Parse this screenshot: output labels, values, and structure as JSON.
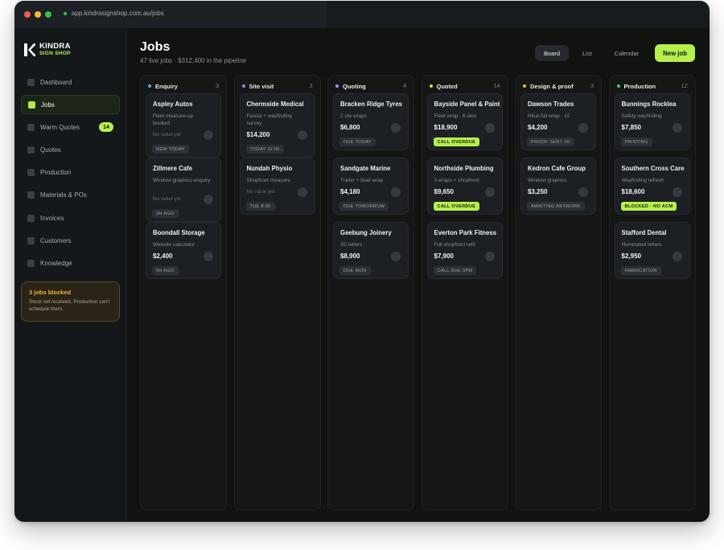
{
  "browser": {
    "url": "app.kindrasignshop.com.au/jobs"
  },
  "brand": {
    "name": "KINDRA",
    "sub": "SIGN SHOP"
  },
  "sidebar": {
    "items": [
      {
        "label": "Dashboard"
      },
      {
        "label": "Jobs",
        "active": true
      },
      {
        "label": "Warm Quotes",
        "badge": "14"
      },
      {
        "label": "Quotes"
      },
      {
        "label": "Production"
      },
      {
        "label": "Materials & POs"
      },
      {
        "label": "Invoices"
      },
      {
        "label": "Customers"
      },
      {
        "label": "Knowledge"
      }
    ],
    "alert": {
      "title": "3 jobs blocked",
      "body": "Stock not received. Production can't schedule them."
    }
  },
  "header": {
    "title": "Jobs",
    "subtitle": "47 live jobs · $312,400 in the pipeline",
    "views": [
      "Board",
      "List",
      "Calendar"
    ],
    "new_button": "New job"
  },
  "colors": {
    "accent": "#b5f04b",
    "enquiry": "#5aa9f0",
    "site_visit": "#8a8df5",
    "quoting": "#a78bfa",
    "quoted": "#b5f04b",
    "design": "#f2b632",
    "production": "#3ecf6a"
  },
  "columns": [
    {
      "title": "Enquiry",
      "count": "3",
      "dot": "#5aa9f0",
      "cards": [
        {
          "name": "Aspley Autos",
          "desc": "Fleet measure-up booked",
          "value": "No value yet",
          "tag": "NEW TODAY"
        },
        {
          "name": "Zillmere Cafe",
          "desc": "Window graphics enquiry",
          "value": "No value yet",
          "tag": "2H AGO"
        },
        {
          "name": "Boondall Storage",
          "desc": "Website calculator",
          "value": "$2,400",
          "tag": "5H AGO"
        }
      ]
    },
    {
      "title": "Site visit",
      "count": "2",
      "dot": "#8a8df5",
      "cards": [
        {
          "name": "Chermside Medical",
          "desc": "Fascia + wayfinding survey",
          "value": "$14,200",
          "tag": "TODAY 11:00"
        },
        {
          "name": "Nundah Physio",
          "desc": "Shopfront measure",
          "value": "No value yet",
          "tag": "TUE 8:30"
        }
      ]
    },
    {
      "title": "Quoting",
      "count": "4",
      "dot": "#a78bfa",
      "cards": [
        {
          "name": "Bracken Ridge Tyres",
          "desc": "2 ute wraps",
          "value": "$6,800",
          "tag": "DUE TODAY"
        },
        {
          "name": "Sandgate Marine",
          "desc": "Trailer + boat wrap",
          "value": "$4,180",
          "tag": "DUE TOMORROW"
        },
        {
          "name": "Geebung Joinery",
          "desc": "3D letters",
          "value": "$8,900",
          "tag": "DUE MON"
        }
      ]
    },
    {
      "title": "Quoted",
      "count": "14",
      "dot": "#b5f04b",
      "cards": [
        {
          "name": "Bayside Panel & Paint",
          "desc": "Fleet wrap · 6 utes",
          "value": "$18,900",
          "tag": "CALL OVERDUE",
          "hot": true
        },
        {
          "name": "Northside Plumbing",
          "desc": "3 wraps + shopfront",
          "value": "$9,650",
          "tag": "CALL OVERDUE",
          "hot": true
        },
        {
          "name": "Everton Park Fitness",
          "desc": "Full shopfront refit",
          "value": "$7,900",
          "tag": "CALL DUE 3PM"
        }
      ]
    },
    {
      "title": "Design & proof",
      "count": "3",
      "dot": "#f2b632",
      "cards": [
        {
          "name": "Dawson Trades",
          "desc": "Hilux full wrap · v2",
          "value": "$4,200",
          "tag": "PROOF SENT 2D"
        },
        {
          "name": "Kedron Cafe Group",
          "desc": "Window graphics",
          "value": "$3,250",
          "tag": "AWAITING ARTWORK"
        }
      ]
    },
    {
      "title": "Production",
      "count": "12",
      "dot": "#3ecf6a",
      "cards": [
        {
          "name": "Bunnings Rocklea",
          "desc": "Safety wayfinding",
          "value": "$7,850",
          "tag": "PRINTING"
        },
        {
          "name": "Southern Cross Care",
          "desc": "Wayfinding refresh",
          "value": "$18,600",
          "tag": "BLOCKED · NO ACM",
          "hot": true
        },
        {
          "name": "Stafford Dental",
          "desc": "Illuminated letters",
          "value": "$2,950",
          "tag": "FABRICATION"
        }
      ]
    }
  ]
}
